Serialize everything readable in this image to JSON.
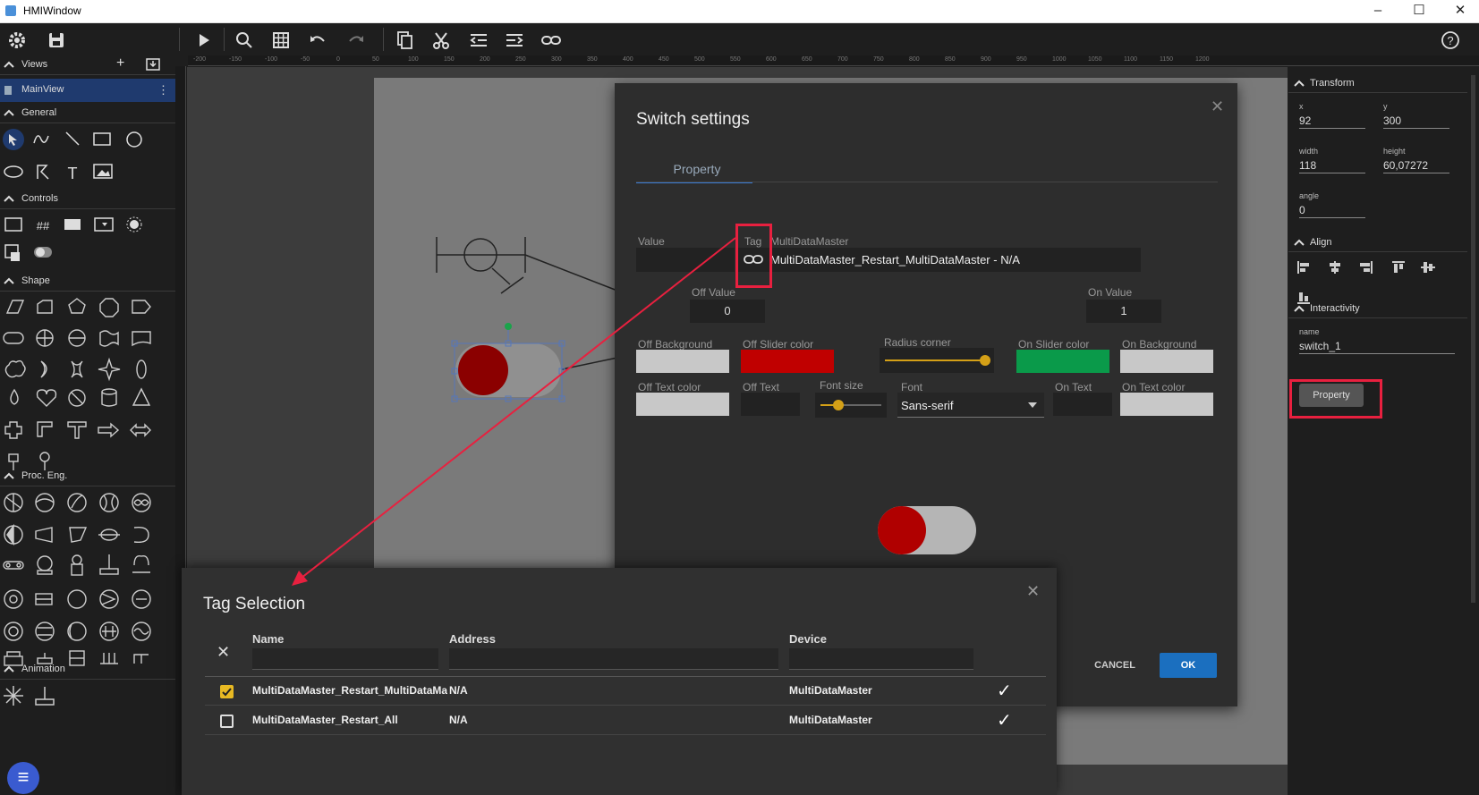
{
  "window": {
    "title": "HMIWindow",
    "minimize": "–",
    "maximize": "☐",
    "close": "✕"
  },
  "toolbar": {
    "left_icons": [
      "gear-icon",
      "save-icon"
    ],
    "icons": [
      "play-icon",
      "zoom-icon",
      "grid-icon",
      "undo-icon",
      "redo-icon",
      "copy-icon",
      "cut-icon",
      "indent-icon",
      "outdent-icon",
      "link-icon"
    ],
    "help": "?"
  },
  "sidebar": {
    "views": {
      "label": "Views",
      "add": "+",
      "import": "import-icon"
    },
    "main_view": {
      "label": "MainView",
      "menu": "⋮"
    },
    "sections": [
      "General",
      "Controls",
      "Shape",
      "Proc. Eng.",
      "Animation"
    ]
  },
  "ruler": {
    "ticks": [
      "-200",
      "-150",
      "-100",
      "-50",
      "0",
      "50",
      "100",
      "150",
      "200",
      "250",
      "300",
      "350",
      "400",
      "450",
      "500",
      "550",
      "600",
      "650",
      "700",
      "750",
      "800",
      "850",
      "900",
      "950",
      "1000",
      "1050",
      "1100",
      "1150",
      "1200"
    ]
  },
  "right_panel": {
    "transform": {
      "label": "Transform",
      "x_label": "x",
      "x": "92",
      "y_label": "y",
      "y": "300",
      "width_label": "width",
      "width": "118",
      "height_label": "height",
      "height": "60,07272",
      "angle_label": "angle",
      "angle": "0"
    },
    "align": {
      "label": "Align"
    },
    "interactivity": {
      "label": "Interactivity",
      "name_label": "name",
      "name": "switch_1",
      "property_button": "Property"
    }
  },
  "switch_dialog": {
    "title": "Switch settings",
    "tab": "Property",
    "close": "✕",
    "value_label": "Value",
    "tag_label": "Tag",
    "device_label": "MultiDataMaster",
    "tag_value": "MultiDataMaster_Restart_MultiDataMaster - N/A",
    "off_value_label": "Off Value",
    "off_value": "0",
    "on_value_label": "On Value",
    "on_value": "1",
    "off_background_label": "Off Background",
    "off_slider_color_label": "Off Slider color",
    "radius_corner_label": "Radius corner",
    "on_slider_color_label": "On Slider color",
    "on_background_label": "On Background",
    "off_text_color_label": "Off Text color",
    "off_text_label": "Off Text",
    "font_size_label": "Font size",
    "font_label": "Font",
    "font_value": "Sans-serif",
    "on_text_label": "On Text",
    "on_text_color_label": "On Text color",
    "cancel": "CANCEL",
    "ok": "OK",
    "colors": {
      "off_background": "#c8c8c8",
      "off_slider": "#c00000",
      "on_slider": "#0a9a4a",
      "on_background": "#c8c8c8",
      "off_text": "#c8c8c8",
      "on_text": "#c8c8c8",
      "ok": "#1b6fbf",
      "slider_thumb": "#d4a017"
    },
    "radius_corner_level": 0.95,
    "font_size_level": 0.3
  },
  "tag_dialog": {
    "title": "Tag Selection",
    "close": "✕",
    "clear": "✕",
    "columns": [
      "Name",
      "Address",
      "Device"
    ],
    "rows": [
      {
        "checked": true,
        "name": "MultiDataMaster_Restart_MultiDataMa",
        "address": "N/A",
        "device": "MultiDataMaster",
        "mark": "✓"
      },
      {
        "checked": false,
        "name": "MultiDataMaster_Restart_All",
        "address": "N/A",
        "device": "MultiDataMaster",
        "mark": "✓"
      }
    ]
  },
  "fab": "≡",
  "colors": {
    "accent": "#e8203f",
    "selection": "#1f3a6e",
    "check": "#e8b923",
    "knob_dark": "#8b0000",
    "knob_red": "#b00000"
  }
}
